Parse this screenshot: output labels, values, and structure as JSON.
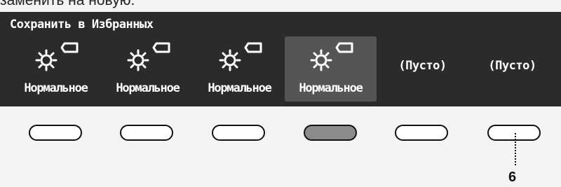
{
  "caption_cut": "заменить на новую.",
  "panel": {
    "title": "Сохранить в Избранных",
    "slots": [
      {
        "label": "Нормальное",
        "icon": "sun-with-tag-icon",
        "selected": false
      },
      {
        "label": "Нормальное",
        "icon": "sun-with-tag-icon",
        "selected": false
      },
      {
        "label": "Нормальное",
        "icon": "sun-with-tag-icon",
        "selected": false
      },
      {
        "label": "Нормальное",
        "icon": "sun-with-tag-icon",
        "selected": true
      },
      {
        "label": "(Пусто)",
        "icon": null,
        "selected": false
      },
      {
        "label": "(Пусто)",
        "icon": null,
        "selected": false
      }
    ]
  },
  "buttons": [
    {
      "pressed": false
    },
    {
      "pressed": false
    },
    {
      "pressed": false
    },
    {
      "pressed": true
    },
    {
      "pressed": false
    },
    {
      "pressed": false
    }
  ],
  "callout": {
    "number": "6"
  },
  "colors": {
    "panel_bg": "#2b2b2b",
    "selected_bg": "#555555",
    "text": "#ffffff",
    "button_pressed": "#8c8c8c",
    "button_outline": "#111111"
  }
}
